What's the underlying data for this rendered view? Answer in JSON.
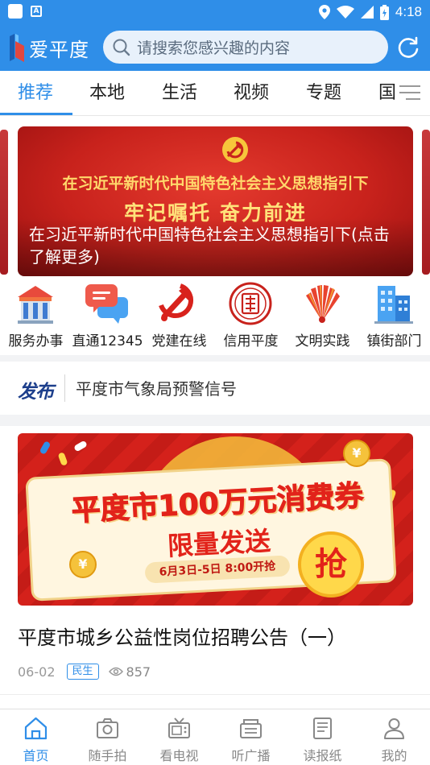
{
  "status_bar": {
    "time": "4:18",
    "icons": [
      "notification-square-icon",
      "a-letter-icon",
      "location-icon",
      "wifi-icon",
      "signal-icon",
      "battery-icon"
    ]
  },
  "header": {
    "app_name": "爱平度",
    "search_placeholder": "请搜索您感兴趣的内容",
    "search_icon": "search-icon",
    "refresh_icon": "refresh-icon",
    "brand_color": "#2f8ee8"
  },
  "tabs": [
    {
      "label": "推荐",
      "active": true
    },
    {
      "label": "本地",
      "active": false
    },
    {
      "label": "生活",
      "active": false
    },
    {
      "label": "视频",
      "active": false
    },
    {
      "label": "专题",
      "active": false
    },
    {
      "label": "国",
      "active": false
    }
  ],
  "banner": {
    "line1": "在习近平新时代中国特色社会主义思想指引下",
    "line2": "牢记嘱托 奋力前进",
    "caption": "在习近平新时代中国特色社会主义思想指引下(点击了解更多)"
  },
  "quick_links": [
    {
      "label": "服务办事",
      "icon": "government-building-icon"
    },
    {
      "label": "直通12345",
      "icon": "chat-bubbles-icon"
    },
    {
      "label": "党建在线",
      "icon": "party-emblem-icon"
    },
    {
      "label": "信用平度",
      "icon": "credit-seal-icon"
    },
    {
      "label": "文明实践",
      "icon": "civilization-fan-icon"
    },
    {
      "label": "镇街部门",
      "icon": "office-buildings-icon"
    }
  ],
  "notice": {
    "badge": "发布",
    "text": "平度市气象局预警信号"
  },
  "promo": {
    "title": "平度市100万元消费券",
    "subtitle": "限量发送",
    "date": "6月3日-5日 8:00开抢",
    "grab": "抢",
    "coin_symbol": "¥"
  },
  "article": {
    "title": "平度市城乡公益性岗位招聘公告（一）",
    "date": "06-02",
    "tag": "民生",
    "views": "857"
  },
  "bottom_nav": [
    {
      "label": "首页",
      "icon": "home-icon",
      "active": true
    },
    {
      "label": "随手拍",
      "icon": "camera-icon",
      "active": false
    },
    {
      "label": "看电视",
      "icon": "tv-icon",
      "active": false
    },
    {
      "label": "听广播",
      "icon": "radio-icon",
      "active": false
    },
    {
      "label": "读报纸",
      "icon": "newspaper-icon",
      "active": false
    },
    {
      "label": "我的",
      "icon": "user-icon",
      "active": false
    }
  ]
}
